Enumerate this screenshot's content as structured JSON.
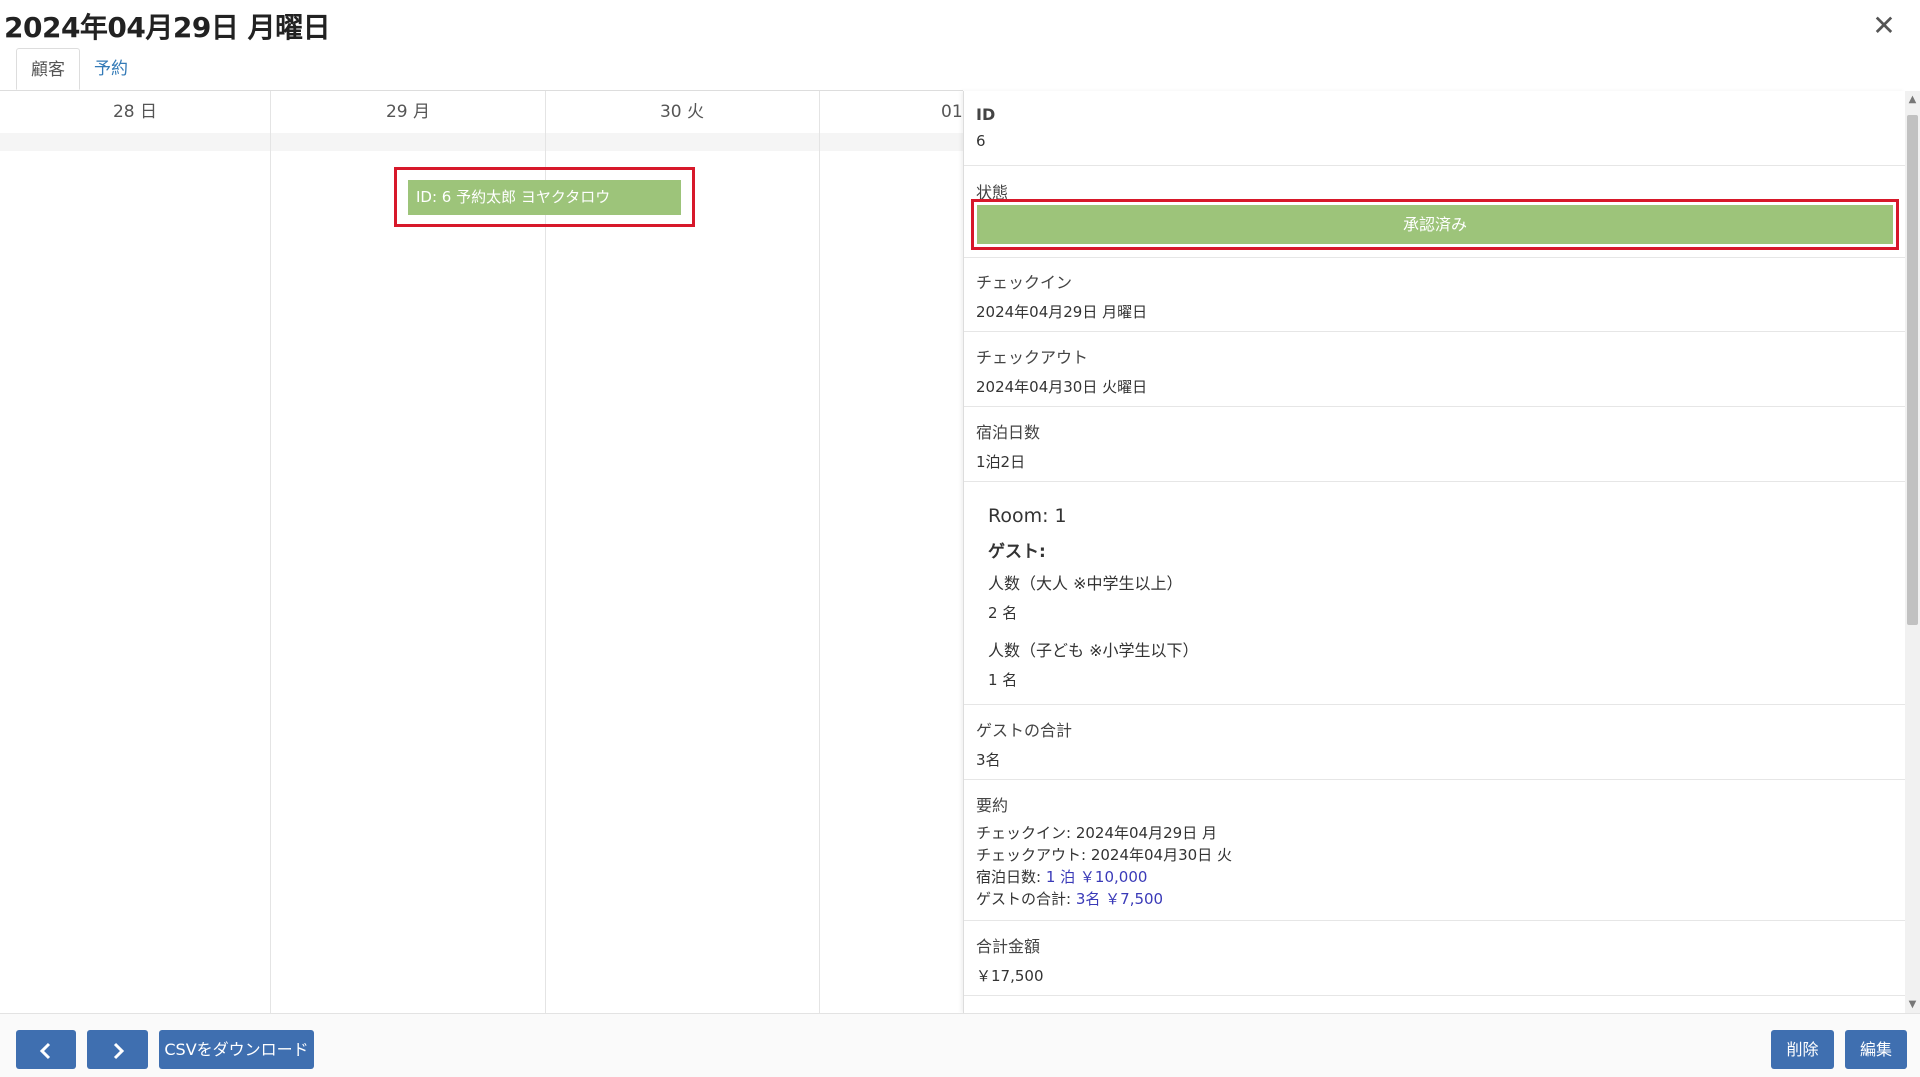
{
  "header": {
    "title": "2024年04月29日 月曜日",
    "close_label": "✕"
  },
  "tabs": [
    {
      "label": "顧客",
      "active": true
    },
    {
      "label": "予約",
      "active": false
    }
  ],
  "calendar": {
    "days": [
      "28 日",
      "29 月",
      "30 火",
      "01"
    ],
    "event": {
      "label": "ID: 6 予約太郎 ヨヤクタロウ",
      "color": "#9dc47a"
    }
  },
  "detail": {
    "id": {
      "label": "ID",
      "value": "6"
    },
    "status": {
      "label": "状態",
      "value": "承認済み",
      "color": "#9dc47a"
    },
    "checkin": {
      "label": "チェックイン",
      "value": "2024年04月29日 月曜日"
    },
    "checkout": {
      "label": "チェックアウト",
      "value": "2024年04月30日 火曜日"
    },
    "nights": {
      "label": "宿泊日数",
      "value": "1泊2日"
    },
    "room": {
      "title": "Room: 1",
      "guest_label": "ゲスト:",
      "adults_label": "人数（大人 ※中学生以上）",
      "adults_value": "2 名",
      "children_label": "人数（子ども ※小学生以下）",
      "children_value": "1 名"
    },
    "guest_total": {
      "label": "ゲストの合計",
      "value": "3名"
    },
    "summary": {
      "label": "要約",
      "checkin_key": "チェックイン:",
      "checkin_val": "2024年04月29日 月",
      "checkout_key": "チェックアウト:",
      "checkout_val": "2024年04月30日 火",
      "nights_key": "宿泊日数:",
      "nights_val": "1 泊 ￥10,000",
      "guests_key": "ゲストの合計:",
      "guests_val": "3名 ￥7,500"
    },
    "total": {
      "label": "合計金額",
      "value": "￥17,500"
    }
  },
  "footer": {
    "prev_icon": "chevron-left-icon",
    "next_icon": "chevron-right-icon",
    "csv_label": "CSVをダウンロード",
    "delete_label": "削除",
    "edit_label": "編集",
    "button_color": "#3f6fb0"
  },
  "highlight_color": "#d7182a"
}
